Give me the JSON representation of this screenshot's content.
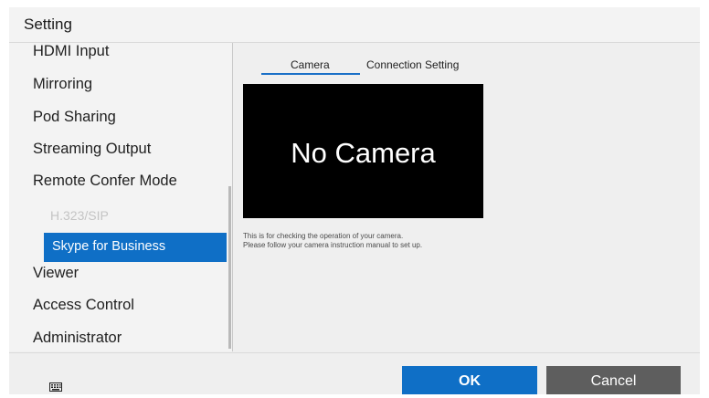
{
  "window": {
    "title": "Setting"
  },
  "sidebar": {
    "items": [
      {
        "label": "HDMI Input"
      },
      {
        "label": "Mirroring"
      },
      {
        "label": "Pod Sharing"
      },
      {
        "label": "Streaming Output"
      },
      {
        "label": "Remote Confer Mode"
      },
      {
        "label": "H.323/SIP"
      },
      {
        "label": "Skype for Business"
      },
      {
        "label": "Viewer"
      },
      {
        "label": "Access Control"
      },
      {
        "label": "Administrator"
      }
    ],
    "selected_label": "Skype for Business",
    "disabled_label": "H.323/SIP"
  },
  "tabs": [
    {
      "label": "Camera",
      "active": true
    },
    {
      "label": "Connection Setting",
      "active": false
    }
  ],
  "preview": {
    "text": "No Camera"
  },
  "info": {
    "line1": "This is for checking the operation of your camera.",
    "line2": "Please follow your camera instruction manual to set up."
  },
  "footer": {
    "keyboard_icon": "keyboard-icon",
    "ok_label": "OK",
    "cancel_label": "Cancel"
  },
  "colors": {
    "accent": "#0f6fc6",
    "cancel": "#5e5e5e",
    "preview_bg": "#000000",
    "disabled_text": "#c4c4c4"
  }
}
